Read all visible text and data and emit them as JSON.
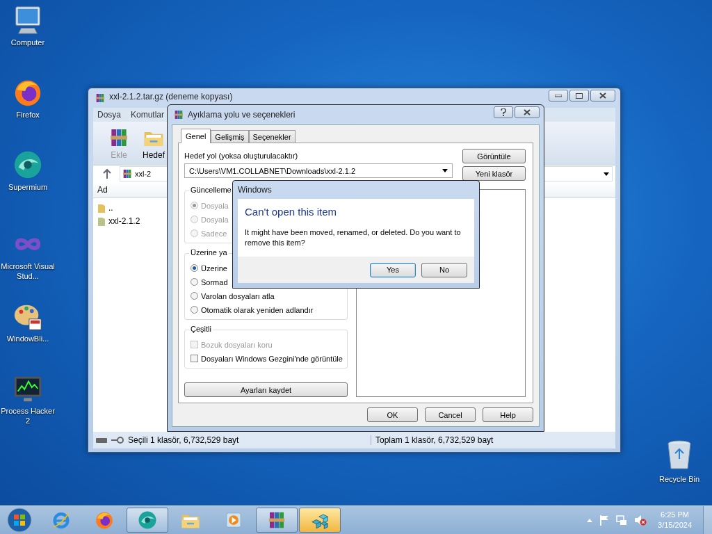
{
  "desktop_icons": [
    {
      "label": "Computer",
      "kind": "computer"
    },
    {
      "label": "Firefox",
      "kind": "firefox"
    },
    {
      "label": "Supermium",
      "kind": "supermium"
    },
    {
      "label": "Microsoft Visual Stud...",
      "kind": "vs"
    },
    {
      "label": "WindowBli...",
      "kind": "palette"
    },
    {
      "label": "Process Hacker 2",
      "kind": "monitor"
    }
  ],
  "recycle_bin": {
    "label": "Recycle Bin"
  },
  "archive_window": {
    "title": "xxl-2.1.2.tar.gz (deneme kopyası)",
    "menu": [
      "Dosya",
      "Komutlar"
    ],
    "toolbar": [
      {
        "label": "Ekle",
        "kind": "add",
        "disabled": true
      },
      {
        "label": "Hedef",
        "kind": "extract",
        "disabled": false
      }
    ],
    "address": "xxl-2",
    "columns": [
      "Ad"
    ],
    "rows": [
      {
        "name": "..",
        "kind": "parent"
      },
      {
        "name": "xxl-2.1.2",
        "kind": "folder"
      }
    ],
    "status_left": "Seçili 1 klasör, 6,732,529 bayt",
    "status_right": "Toplam 1 klasör, 6,732,529 bayt"
  },
  "extract_dialog": {
    "title": "Ayıklama yolu ve seçenekleri",
    "tabs": [
      {
        "label": "Genel",
        "selected": true
      },
      {
        "label": "Gelişmiş",
        "selected": false
      },
      {
        "label": "Seçenekler",
        "selected": false
      }
    ],
    "path_label": "Hedef yol (yoksa oluşturulacaktır)",
    "path_value": "C:\\Users\\VM1.COLLABNET\\Downloads\\xxl-2.1.2",
    "side_buttons": [
      "Görüntüle",
      "Yeni klasör"
    ],
    "groups": [
      {
        "title": "Güncelleme",
        "options": [
          {
            "kind": "radio",
            "label": "Dosyala",
            "selected": true,
            "disabled": true
          },
          {
            "kind": "radio",
            "label": "Dosyala",
            "selected": false,
            "disabled": true
          },
          {
            "kind": "radio",
            "label": "Sadece",
            "selected": false,
            "disabled": true
          }
        ]
      },
      {
        "title": "Üzerine ya",
        "options": [
          {
            "kind": "radio",
            "label": "Üzerine",
            "selected": true,
            "disabled": false
          },
          {
            "kind": "radio",
            "label": "Sormad",
            "selected": false,
            "disabled": false
          },
          {
            "kind": "radio",
            "label": "Varolan dosyaları atla",
            "selected": false,
            "disabled": false
          },
          {
            "kind": "radio",
            "label": "Otomatik olarak yeniden adlandır",
            "selected": false,
            "disabled": false
          }
        ]
      },
      {
        "title": "Çeşitli",
        "options": [
          {
            "kind": "checkbox",
            "label": "Bozuk dosyaları koru",
            "checked": false,
            "disabled": true
          },
          {
            "kind": "checkbox",
            "label": "Dosyaları Windows Gezgini'nde görüntüle",
            "checked": false,
            "disabled": false
          }
        ]
      }
    ],
    "save_button": "Ayarları kaydet",
    "buttons": [
      "OK",
      "Cancel",
      "Help"
    ]
  },
  "message_box": {
    "title": "Windows",
    "heading": "Can't open this item",
    "body": "It might have been moved, renamed, or deleted. Do you want to remove this item?",
    "buttons": [
      {
        "label": "Yes",
        "selected": true
      },
      {
        "label": "No",
        "selected": false
      }
    ]
  },
  "taskbar": {
    "items": [
      {
        "kind": "ie",
        "running": false,
        "selected": false
      },
      {
        "kind": "firefox",
        "running": false,
        "selected": false
      },
      {
        "kind": "supermium",
        "running": true,
        "selected": false
      },
      {
        "kind": "explorer",
        "running": false,
        "selected": false
      },
      {
        "kind": "media",
        "running": false,
        "selected": false
      },
      {
        "kind": "archive",
        "running": true,
        "selected": false
      },
      {
        "kind": "cubes",
        "running": true,
        "selected": true
      }
    ],
    "time": "6:25 PM",
    "date": "3/15/2024"
  }
}
